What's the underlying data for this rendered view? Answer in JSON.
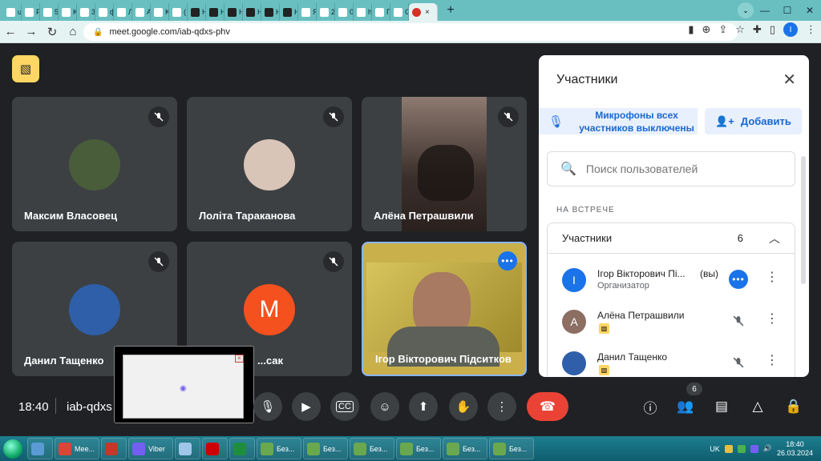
{
  "browser": {
    "tabs": [
      {
        "letter": "u",
        "color": "#ffffff"
      },
      {
        "letter": "P",
        "color": "#ffffff"
      },
      {
        "letter": "5",
        "color": "#ffffff"
      },
      {
        "letter": "K",
        "color": "#ffffff"
      },
      {
        "letter": "3",
        "color": "#ffffff"
      },
      {
        "letter": "ф",
        "color": "#ffffff"
      },
      {
        "letter": "Л",
        "color": "#ffffff"
      },
      {
        "letter": "A",
        "color": "#ffffff"
      },
      {
        "letter": "K",
        "color": "#ffffff"
      },
      {
        "letter": "(",
        "color": "#ffffff"
      },
      {
        "letter": "H",
        "color": "#222222"
      },
      {
        "letter": "H",
        "color": "#222222"
      },
      {
        "letter": "H",
        "color": "#222222"
      },
      {
        "letter": "H",
        "color": "#222222"
      },
      {
        "letter": "H",
        "color": "#222222"
      },
      {
        "letter": "H",
        "color": "#222222"
      },
      {
        "letter": "Я",
        "color": "#ffffff"
      },
      {
        "letter": "2",
        "color": "#ffffff"
      },
      {
        "letter": "0",
        "color": "#ffffff"
      },
      {
        "letter": "h",
        "color": "#ffffff"
      },
      {
        "letter": "Г",
        "color": "#ffffff"
      },
      {
        "letter": "G",
        "color": "#ffffff"
      }
    ],
    "active_tab_close": "×",
    "new_tab": "+",
    "url": "meet.google.com/iab-qdxs-phv",
    "profile_letter": "I"
  },
  "meet": {
    "tiles": [
      {
        "name": "Максим Власовец",
        "avatar_color": "#4a5d3a"
      },
      {
        "name": "Лоліта Тараканова",
        "avatar_color": "#d9c4b8"
      },
      {
        "name": "Алёна Петрашвили",
        "avatar_color": "#3b2f2b"
      },
      {
        "name": "Данил Тащенко",
        "avatar_color": "#2f5fa8"
      },
      {
        "name": "...сак",
        "avatar_letter": "M",
        "avatar_color": "#f4511e"
      },
      {
        "name": "Ігор Вікторович Підситков",
        "avatar_color": "#c9b04a"
      }
    ],
    "self_more": "•••",
    "clock": "18:40",
    "meeting_code": "iab-qdxs",
    "participant_count": "6",
    "hangup_color": "#ea4335"
  },
  "panel": {
    "title": "Участники",
    "mute_all": "Микрофоны всех участников выключены",
    "add_label": "Добавить",
    "search_placeholder": "Поиск пользователей",
    "section_label": "НА ВСТРЕЧЕ",
    "group_label": "Участники",
    "group_count": "6",
    "participants": [
      {
        "name": "Ігор Вікторович Пі...",
        "suffix": "(вы)",
        "subtitle": "Организатор",
        "avatar_letter": "I",
        "avatar_color": "#1a73e8"
      },
      {
        "name": "Алёна Петрашвили",
        "avatar_letter": "А",
        "avatar_color": "#8d6e63"
      },
      {
        "name": "Данил Тащенко",
        "avatar_letter": "",
        "avatar_color": "#2f5fa8"
      }
    ]
  },
  "taskbar": {
    "items": [
      {
        "label": "",
        "color": "#5b9bd5"
      },
      {
        "label": "Мее...",
        "color": "#db4437"
      },
      {
        "label": "",
        "color": "#c0392b"
      },
      {
        "label": "Viber",
        "color": "#7360f2"
      },
      {
        "label": "",
        "color": "#9fc5e8"
      },
      {
        "label": "",
        "color": "#cc0000"
      },
      {
        "label": "",
        "color": "#1e8e3e"
      },
      {
        "label": "Без...",
        "color": "#6aa84f"
      },
      {
        "label": "Без...",
        "color": "#6aa84f"
      },
      {
        "label": "Без...",
        "color": "#6aa84f"
      },
      {
        "label": "Без...",
        "color": "#6aa84f"
      },
      {
        "label": "Без...",
        "color": "#6aa84f"
      },
      {
        "label": "Без...",
        "color": "#6aa84f"
      }
    ],
    "lang": "UK",
    "time": "18:40",
    "date": "26.03.2024"
  }
}
